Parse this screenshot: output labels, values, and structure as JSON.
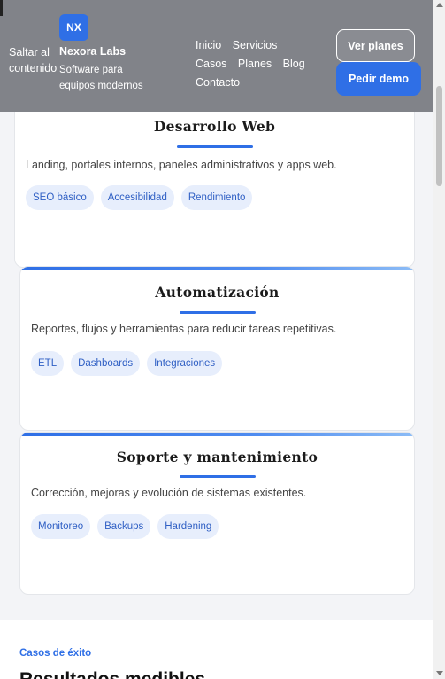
{
  "header": {
    "skip_link": "Saltar al contenido",
    "logo_initials": "NX",
    "brand_name": "Nexora Labs",
    "brand_tagline": "Software para equipos modernos",
    "nav": [
      "Inicio",
      "Servicios",
      "Casos",
      "Planes",
      "Blog",
      "Contacto"
    ],
    "btn_plans": "Ver planes",
    "btn_demo": "Pedir demo"
  },
  "cards": [
    {
      "title": "Desarrollo Web",
      "description": "Landing, portales internos, paneles administrativos y apps web.",
      "tags": [
        "SEO básico",
        "Accesibilidad",
        "Rendimiento"
      ]
    },
    {
      "title": "Automatización",
      "description": "Reportes, flujos y herramientas para reducir tareas repetitivas.",
      "tags": [
        "ETL",
        "Dashboards",
        "Integraciones"
      ]
    },
    {
      "title": "Soporte y mantenimiento",
      "description": "Corrección, mejoras y evolución de sistemas existentes.",
      "tags": [
        "Monitoreo",
        "Backups",
        "Hardening"
      ]
    }
  ],
  "results": {
    "eyebrow": "Casos de éxito",
    "title": "Resultados medibles"
  },
  "colors": {
    "accent": "#2f6fe6",
    "tag_bg": "#e7eefc"
  }
}
